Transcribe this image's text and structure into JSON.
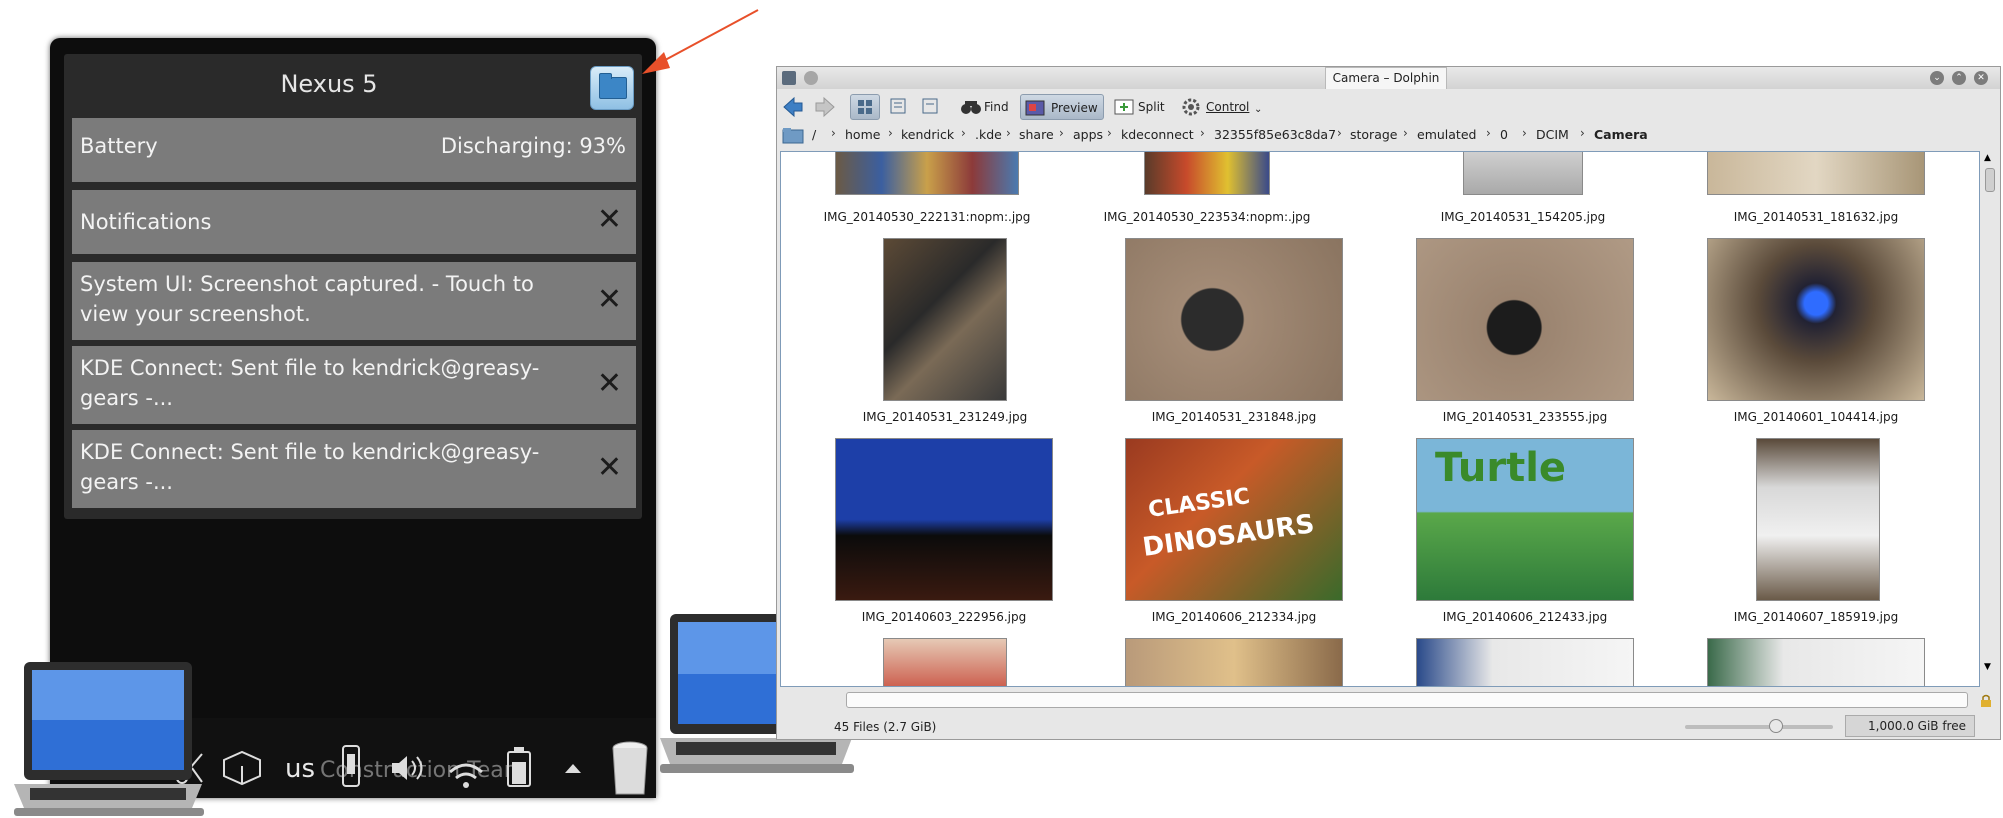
{
  "plasmoid": {
    "device_name": "Nexus 5",
    "battery": {
      "label": "Battery",
      "status": "Discharging: 93%"
    },
    "notifications_header": "Notifications",
    "notifications": [
      {
        "text": "System UI: Screenshot captured. - Touch to view your screenshot."
      },
      {
        "text": "KDE Connect: Sent file to kendrick@greasy-gears -..."
      },
      {
        "text": "KDE Connect: Sent file to kendrick@greasy-gears -..."
      }
    ],
    "close_glyph": "✕"
  },
  "taskbar": {
    "keyboard_layout": "us",
    "ghost_text": "Construction Team"
  },
  "dolphin": {
    "window_title": "Camera – Dolphin",
    "toolbar": {
      "find": "Find",
      "preview": "Preview",
      "split": "Split",
      "control": "Control"
    },
    "breadcrumbs": [
      "/",
      "home",
      "kendrick",
      ".kde",
      "share",
      "apps",
      "kdeconnect",
      "32355f85e63c8da7",
      "storage",
      "emulated",
      "0",
      "DCIM",
      "Camera"
    ],
    "files": [
      "IMG_20140530_222131:nopm:.jpg",
      "IMG_20140530_223534:nopm:.jpg",
      "IMG_20140531_154205.jpg",
      "IMG_20140531_181632.jpg",
      "IMG_20140531_231249.jpg",
      "IMG_20140531_231848.jpg",
      "IMG_20140531_233555.jpg",
      "IMG_20140601_104414.jpg",
      "IMG_20140603_222956.jpg",
      "IMG_20140606_212334.jpg",
      "IMG_20140606_212433.jpg",
      "IMG_20140607_185919.jpg"
    ],
    "thumb_texts": {
      "dinosaurs_line1": "CLASSIC",
      "dinosaurs_line2": "DINOSAURS",
      "turtle": "Turtle"
    },
    "status": "45 Files (2.7 GiB)",
    "free_space": "1,000.0 GiB free"
  },
  "colors": {
    "plasmoid_bg": "#0d0d0d",
    "row_bg": "#7b7b7b",
    "accent_arrow": "#e8502a",
    "dolphin_frame": "#e7e7e7"
  }
}
